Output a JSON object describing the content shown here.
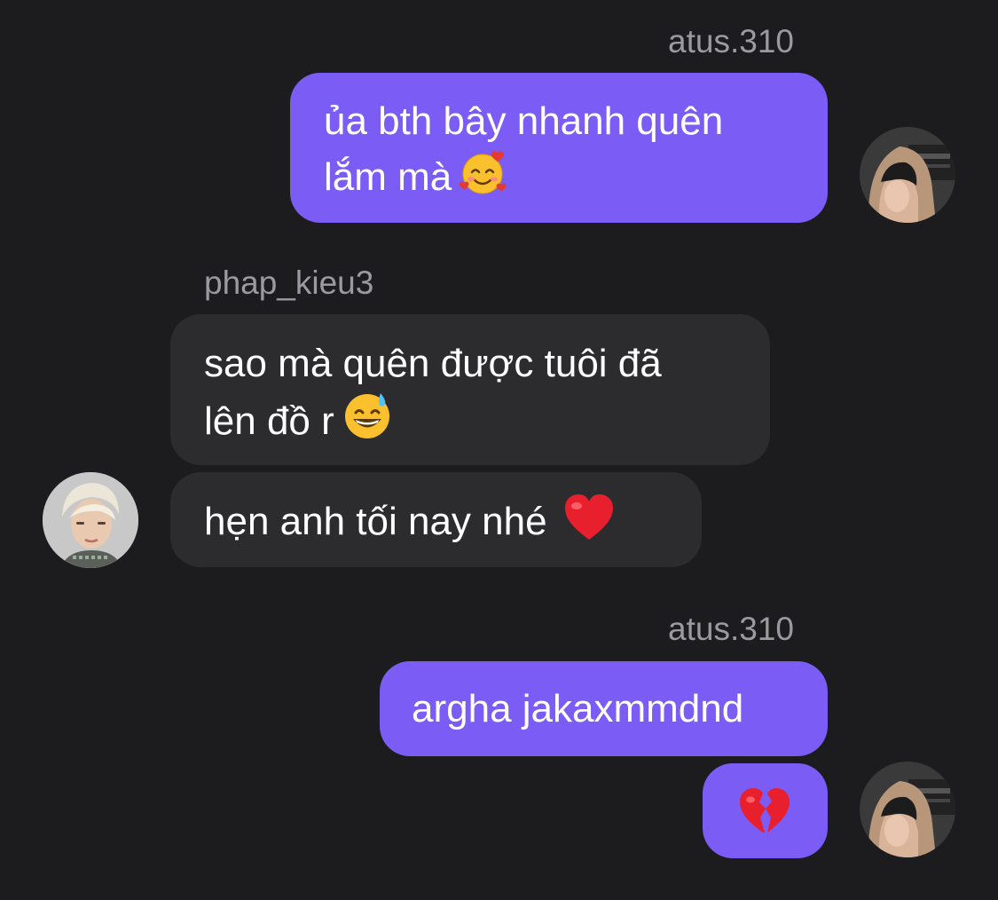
{
  "messages": {
    "group1": {
      "sender": "atus.310",
      "line1": "ủa bth bây nhanh quên",
      "line2": "lắm mà",
      "emoji": "smiling-face-with-hearts"
    },
    "group2": {
      "sender": "phap_kieu3",
      "msg1_line1": "sao mà quên được tuôi đã",
      "msg1_line2": "lên đồ r",
      "msg1_emoji": "grinning-face-with-sweat",
      "msg2_text": "hẹn anh tối nay nhé",
      "msg2_emoji": "red-heart"
    },
    "group3": {
      "sender": "atus.310",
      "msg1_text": "argha jakaxmmdnd",
      "msg2_emoji": "broken-heart"
    }
  },
  "colors": {
    "background": "#1c1c1e",
    "outgoing_bubble": "#7b5cf5",
    "incoming_bubble": "#2c2c2e",
    "sender_name": "#9a9aa0"
  },
  "avatars": {
    "atus": "avatar-atus",
    "phap": "avatar-phap-kieu3"
  }
}
